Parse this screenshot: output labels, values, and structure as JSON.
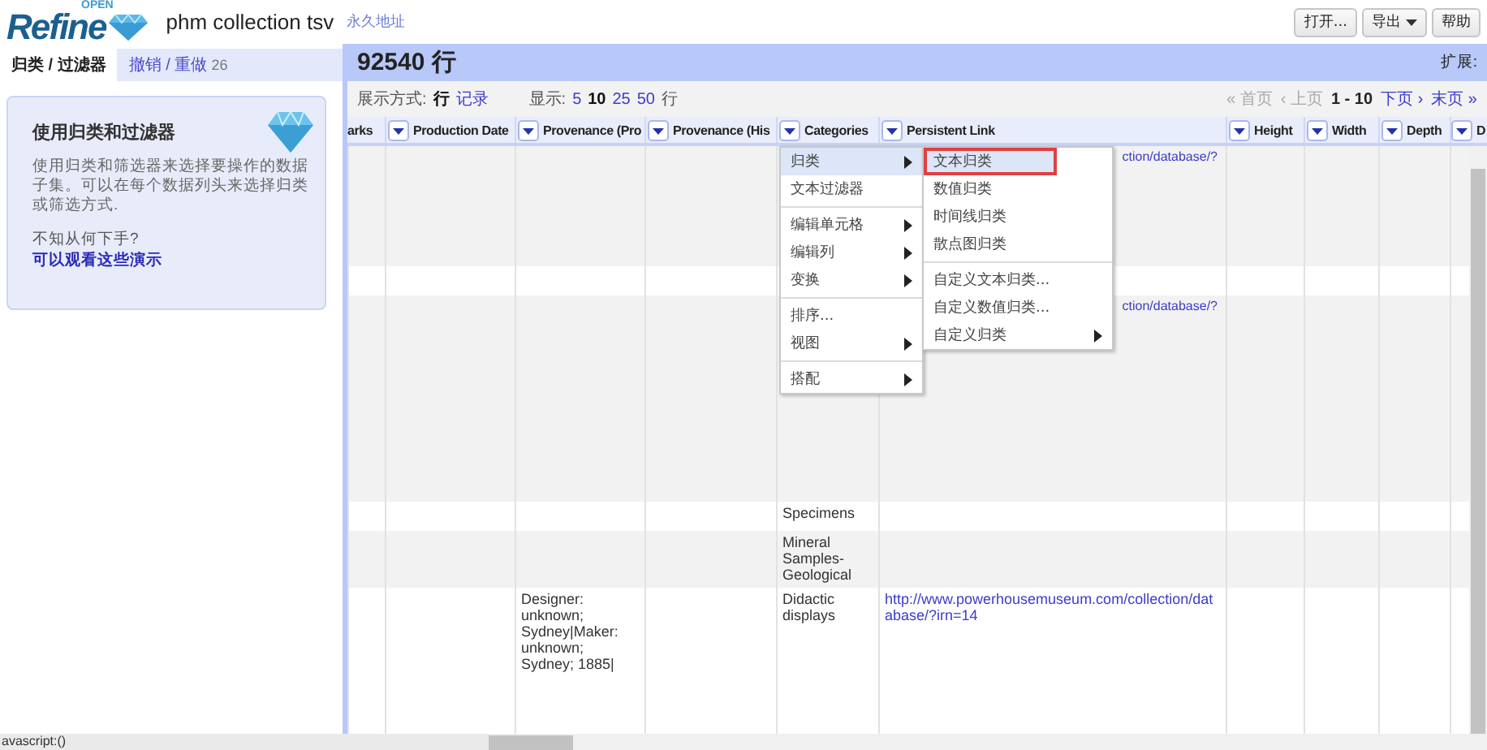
{
  "header": {
    "logo": {
      "tag": "OPEN",
      "name": "Refine"
    },
    "project_title": "phm collection tsv",
    "permalink": "永久地址",
    "buttons": [
      {
        "label": "打开...",
        "dropdown": false
      },
      {
        "label": "导出",
        "dropdown": true
      },
      {
        "label": "帮助",
        "dropdown": false
      }
    ]
  },
  "left_panel": {
    "tabs": [
      {
        "label": "归类 / 过滤器",
        "selected": true
      },
      {
        "label": "撤销 / 重做",
        "selected": false,
        "count": "26"
      }
    ],
    "card": {
      "title": "使用归类和过滤器",
      "body": "使用归类和筛选器来选择要操作的数据子集。可以在每个数据列头来选择归类或筛选方式.",
      "question": "不知从何下手?",
      "link": "可以观看这些演示"
    }
  },
  "summary": {
    "row_count": "92540 行",
    "extensions": "扩展:"
  },
  "view_bar": {
    "mode_label": "展示方式:",
    "modes": [
      {
        "label": "行",
        "selected": true
      },
      {
        "label": "记录",
        "selected": false
      }
    ],
    "show_label": "显示:",
    "page_sizes": [
      {
        "label": "5",
        "selected": false
      },
      {
        "label": "10",
        "selected": true
      },
      {
        "label": "25",
        "selected": false
      },
      {
        "label": "50",
        "selected": false
      }
    ],
    "show_unit": "行",
    "pager": [
      {
        "label": "« 首页",
        "disabled": true
      },
      {
        "label": "‹ 上页",
        "disabled": true
      },
      {
        "label": "1 - 10",
        "kind": "range"
      },
      {
        "label": "下页 ›",
        "disabled": false
      },
      {
        "label": "末页 »",
        "disabled": false
      }
    ]
  },
  "table": {
    "columns": [
      {
        "label": "arks",
        "menu": false
      },
      {
        "label": "Production Date",
        "menu": true
      },
      {
        "label": "Provenance (Pro",
        "menu": true
      },
      {
        "label": "Provenance (His",
        "menu": true
      },
      {
        "label": "Categories",
        "menu": true
      },
      {
        "label": "Persistent Link",
        "menu": true
      },
      {
        "label": "Height",
        "menu": true
      },
      {
        "label": "Width",
        "menu": true
      },
      {
        "label": "Depth",
        "menu": true
      },
      {
        "label": "D",
        "menu": true
      }
    ],
    "rows": [
      {
        "persistent_link": {
          "text": "ction/database/?",
          "covered": true
        }
      },
      {},
      {
        "persistent_link": {
          "text": "ction/database/?",
          "covered": true
        }
      },
      {
        "categories": "Specimens"
      },
      {
        "categories": "Mineral Samples-Geological"
      },
      {
        "provenance_pro": "Designer: unknown; Sydney|Maker: unknown; Sydney; 1885|",
        "categories": "Didactic displays",
        "persistent_link": {
          "text": "http://www.powerhousemuseum.com/collection/database/?irn=14",
          "covered": false
        }
      }
    ]
  },
  "column_menu": {
    "items": [
      {
        "kind": "item",
        "label": "归类",
        "submenu": true,
        "selected": true
      },
      {
        "kind": "item",
        "label": "文本过滤器",
        "submenu": false,
        "selected": false
      },
      {
        "kind": "separator"
      },
      {
        "kind": "item",
        "label": "编辑单元格",
        "submenu": true,
        "selected": false
      },
      {
        "kind": "item",
        "label": "编辑列",
        "submenu": true,
        "selected": false
      },
      {
        "kind": "item",
        "label": "变换",
        "submenu": true,
        "selected": false
      },
      {
        "kind": "separator"
      },
      {
        "kind": "item",
        "label": "排序...",
        "submenu": false,
        "selected": false
      },
      {
        "kind": "item",
        "label": "视图",
        "submenu": true,
        "selected": false
      },
      {
        "kind": "separator"
      },
      {
        "kind": "item",
        "label": "搭配",
        "submenu": true,
        "selected": false
      }
    ],
    "submenu": [
      {
        "kind": "item",
        "label": "文本归类",
        "submenu": false,
        "selected": true,
        "marked": true
      },
      {
        "kind": "item",
        "label": "数值归类",
        "submenu": false,
        "selected": false,
        "marked": false
      },
      {
        "kind": "item",
        "label": "时间线归类",
        "submenu": false,
        "selected": false,
        "marked": false
      },
      {
        "kind": "item",
        "label": "散点图归类",
        "submenu": false,
        "selected": false,
        "marked": false
      },
      {
        "kind": "separator"
      },
      {
        "kind": "item",
        "label": "自定义文本归类...",
        "submenu": false,
        "selected": false,
        "marked": false
      },
      {
        "kind": "item",
        "label": "自定义数值归类...",
        "submenu": false,
        "selected": false,
        "marked": false
      },
      {
        "kind": "item",
        "label": "自定义归类",
        "submenu": true,
        "selected": false,
        "marked": false
      }
    ]
  },
  "status_bar": {
    "text": "avascript:()"
  }
}
